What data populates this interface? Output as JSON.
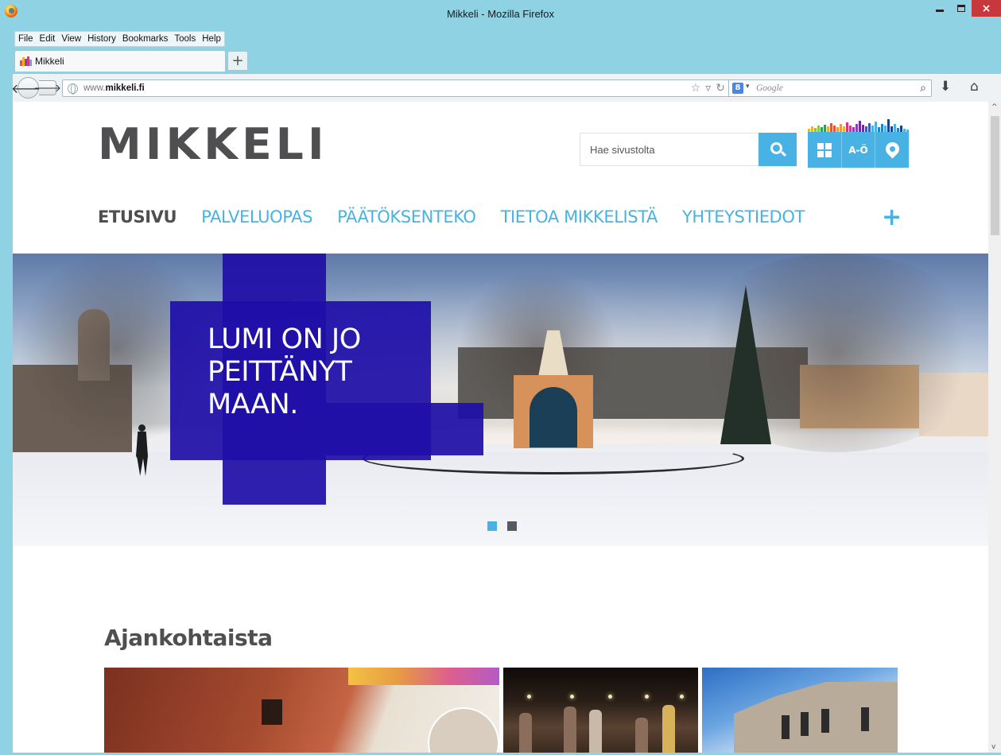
{
  "window": {
    "title": "Mikkeli - Mozilla Firefox",
    "close_glyph": "×"
  },
  "menu": [
    "File",
    "Edit",
    "View",
    "History",
    "Bookmarks",
    "Tools",
    "Help"
  ],
  "tab": {
    "label": "Mikkeli",
    "new_tab_glyph": "+"
  },
  "navbar": {
    "url_prefix": "www.",
    "url_domain": "mikkeli.fi",
    "search_engine_placeholder": "Google"
  },
  "site": {
    "logo": "MIKKELI",
    "search_placeholder": "Hae sivustolta",
    "az_label": "A-Ö",
    "nav": [
      {
        "label": "ETUSIVU",
        "active": true
      },
      {
        "label": "PALVELUOPAS",
        "active": false
      },
      {
        "label": "PÄÄTÖKSENTEKO",
        "active": false
      },
      {
        "label": "TIETOA MIKKELISTÄ",
        "active": false
      },
      {
        "label": "YHTEYSTIEDOT",
        "active": false
      }
    ],
    "more_glyph": "+",
    "hero": {
      "text_line1": "LUMI ON JO",
      "text_line2": "PEITTÄNYT",
      "text_line3": "MAAN.",
      "slide_count": 2,
      "active_slide": 1
    },
    "section_title": "Ajankohtaista"
  },
  "colors": {
    "brand_blue": "#49b2e4",
    "hero_navy": "#1f0fa8",
    "text_gray": "#4f4f52",
    "chrome_teal": "#8ed2e3",
    "close_red": "#c7383d"
  },
  "icons": {
    "browser": "firefox-logo-icon",
    "back": "back-arrow-icon",
    "forward": "forward-arrow-icon",
    "site_security": "globe-icon",
    "bookmark": "star-icon",
    "reload": "reload-icon",
    "search": "magnifier-icon",
    "downloads": "download-arrow-icon",
    "home": "home-icon",
    "site_search": "search-icon",
    "site_grid": "grid-icon",
    "site_map": "map-pin-icon"
  }
}
